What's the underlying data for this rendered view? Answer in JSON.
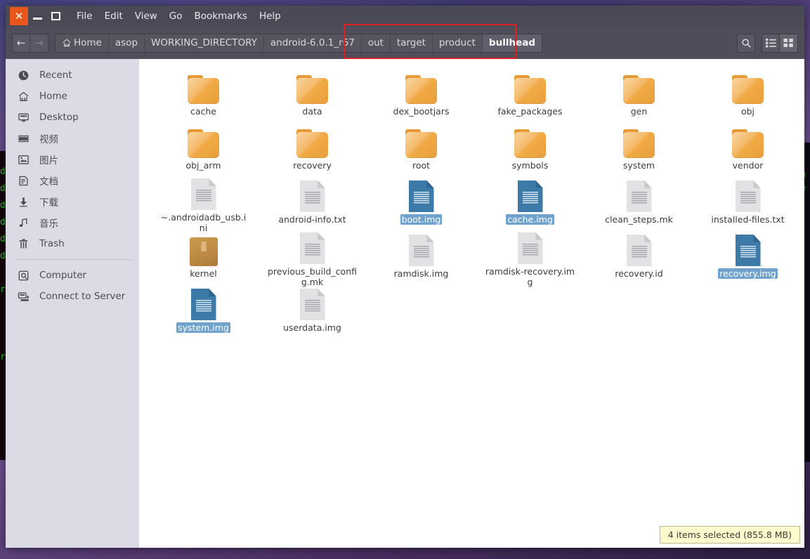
{
  "window": {
    "controls": {
      "close": "✕",
      "minimize": "minimize",
      "maximize": "maximize"
    },
    "menus": [
      "File",
      "Edit",
      "View",
      "Go",
      "Bookmarks",
      "Help"
    ]
  },
  "toolbar": {
    "back_glyph": "←",
    "forward_glyph": "→",
    "breadcrumbs": [
      {
        "label": "Home",
        "icon": "home-icon",
        "current": false
      },
      {
        "label": "asop",
        "current": false
      },
      {
        "label": "WORKING_DIRECTORY",
        "current": false
      },
      {
        "label": "android-6.0.1_r67",
        "current": false
      },
      {
        "label": "out",
        "current": false
      },
      {
        "label": "target",
        "current": false
      },
      {
        "label": "product",
        "current": false
      },
      {
        "label": "bullhead",
        "current": true
      }
    ],
    "search_icon": "search-icon",
    "list_view_icon": "list-view-icon",
    "grid_view_icon": "grid-view-icon"
  },
  "annotation": {
    "color": "#e02020",
    "shape": "rectangle"
  },
  "sidebar": {
    "items": [
      {
        "label": "Recent",
        "icon": "clock-icon"
      },
      {
        "label": "Home",
        "icon": "home-icon"
      },
      {
        "label": "Desktop",
        "icon": "monitor-icon"
      },
      {
        "label": "视频",
        "icon": "video-icon"
      },
      {
        "label": "图片",
        "icon": "picture-icon"
      },
      {
        "label": "文档",
        "icon": "document-icon"
      },
      {
        "label": "下载",
        "icon": "download-icon"
      },
      {
        "label": "音乐",
        "icon": "music-icon"
      },
      {
        "label": "Trash",
        "icon": "trash-icon"
      }
    ],
    "items2": [
      {
        "label": "Computer",
        "icon": "computer-icon"
      },
      {
        "label": "Connect to Server",
        "icon": "server-icon"
      }
    ]
  },
  "files": [
    {
      "name": "cache",
      "type": "folder",
      "selected": false
    },
    {
      "name": "data",
      "type": "folder",
      "selected": false
    },
    {
      "name": "dex_bootjars",
      "type": "folder",
      "selected": false
    },
    {
      "name": "fake_packages",
      "type": "folder",
      "selected": false
    },
    {
      "name": "gen",
      "type": "folder",
      "selected": false
    },
    {
      "name": "obj",
      "type": "folder",
      "selected": false
    },
    {
      "name": "obj_arm",
      "type": "folder",
      "selected": false
    },
    {
      "name": "recovery",
      "type": "folder",
      "selected": false
    },
    {
      "name": "root",
      "type": "folder",
      "selected": false
    },
    {
      "name": "symbols",
      "type": "folder",
      "selected": false
    },
    {
      "name": "system",
      "type": "folder",
      "selected": false
    },
    {
      "name": "vendor",
      "type": "folder",
      "selected": false
    },
    {
      "name": "~.androidadb_usb.ini",
      "type": "document",
      "selected": false
    },
    {
      "name": "android-info.txt",
      "type": "document",
      "selected": false
    },
    {
      "name": "boot.img",
      "type": "document",
      "selected": true
    },
    {
      "name": "cache.img",
      "type": "document",
      "selected": true
    },
    {
      "name": "clean_steps.mk",
      "type": "document",
      "selected": false
    },
    {
      "name": "installed-files.txt",
      "type": "document",
      "selected": false
    },
    {
      "name": "kernel",
      "type": "binary",
      "selected": false
    },
    {
      "name": "previous_build_config.mk",
      "type": "document",
      "selected": false
    },
    {
      "name": "ramdisk.img",
      "type": "document",
      "selected": false
    },
    {
      "name": "ramdisk-recovery.img",
      "type": "document",
      "selected": false
    },
    {
      "name": "recovery.id",
      "type": "document",
      "selected": false
    },
    {
      "name": "recovery.img",
      "type": "document",
      "selected": true
    },
    {
      "name": "system.img",
      "type": "document",
      "selected": true
    },
    {
      "name": "userdata.img",
      "type": "document",
      "selected": false
    }
  ],
  "status": {
    "text": "4 items selected  (855.8 MB)"
  },
  "background": {
    "terminal_left_text": "d\nd\nd\nd\nd\nd\n\nr\n\n\n\nr",
    "terminal_right_text": "sn\nre"
  },
  "colors": {
    "titlebar": "#4b4956",
    "toolbar": "#4f4d59",
    "sidebar": "#dcdae4",
    "close_button": "#e8561c",
    "selection_icon": "#3d7aa8",
    "selection_label": "#6fa3cd",
    "folder": "#f2ad4e",
    "status_bg": "#fbfbcd",
    "annotation": "#e02020"
  }
}
